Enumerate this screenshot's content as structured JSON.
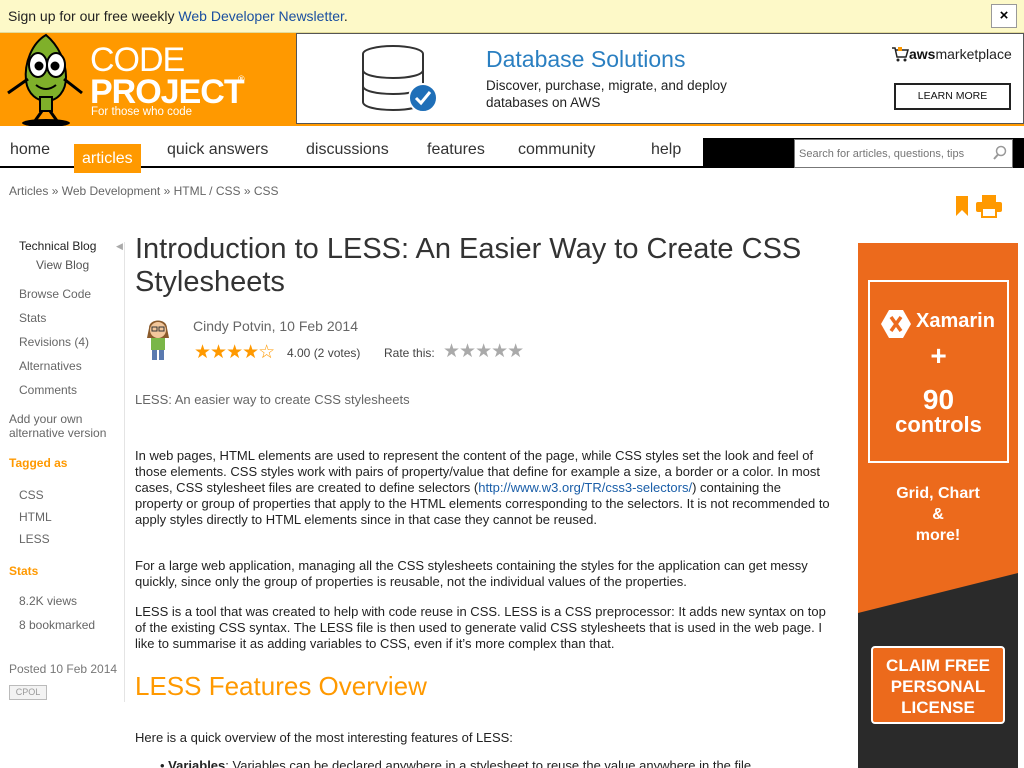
{
  "newsletter": {
    "text": "Sign up for our free weekly",
    "link": "Web Developer Newsletter",
    "period": ".",
    "close": "×"
  },
  "logo": {
    "code": "CODE",
    "project": "PROJECT",
    "reg": "®",
    "tagline": "For those who code"
  },
  "top_ad": {
    "title": "Database Solutions",
    "desc": "Discover, purchase, migrate, and deploy databases on AWS",
    "aws": "aws",
    "marketplace": "marketplace",
    "button": "LEARN MORE"
  },
  "nav": {
    "items": [
      "home",
      "articles",
      "quick answers",
      "discussions",
      "features",
      "community",
      "help"
    ],
    "search_placeholder": "Search for articles, questions, tips"
  },
  "breadcrumb": {
    "items": [
      "Articles",
      "Web Development",
      "HTML / CSS",
      "CSS"
    ],
    "sep": "»"
  },
  "sidebar": {
    "blog_title": "Technical Blog",
    "view_blog": "View Blog",
    "links": [
      "Browse Code",
      "Stats",
      "Revisions (4)",
      "Alternatives",
      "Comments"
    ],
    "add_alt": "Add your own alternative version",
    "tagged_as": "Tagged as",
    "tags": [
      "CSS",
      "HTML",
      "LESS"
    ],
    "stats_heading": "Stats",
    "stats": [
      "8.2K views",
      "8 bookmarked"
    ],
    "posted": "Posted 10 Feb 2014",
    "license": "CPOL"
  },
  "article": {
    "title": "Introduction to LESS: An Easier Way to Create CSS Stylesheets",
    "author": "Cindy Potvin",
    "date": ", 10 Feb 2014",
    "stars": "★★★★☆",
    "rating_value": 4.0,
    "rating": "4.00 (2 votes)",
    "rate_label": "Rate this:",
    "rate_stars": "★★★★★",
    "summary": "LESS: An easier way to create CSS stylesheets",
    "p1_a": "In web pages, HTML elements are used to represent the content of the page, while CSS styles set the look and feel of those elements. CSS styles work with pairs of property/value that define for example a size, a border or a color. In most cases, CSS stylesheet files are created to define selectors (",
    "p1_link": "http://www.w3.org/TR/css3-selectors/",
    "p1_b": ") containing the property or group of properties that apply to the HTML elements corresponding to the selectors. It is not recommended to apply styles directly to HTML elements since in that case they cannot be reused.",
    "p2": "For a large web application, managing all the CSS stylesheets containing the styles for the application can get messy quickly, since only the group of properties is reusable, not the individual values of the properties.",
    "p3": "LESS is a tool that was created to help with code reuse in CSS. LESS is a CSS preprocessor: It adds new syntax on top of the existing CSS syntax. The LESS file is then used to generate valid CSS stylesheets that is used in the web page. I like to summarise it as adding variables to CSS, even if it’s more complex than that.",
    "h2": "LESS Features Overview",
    "quick": "Here is a quick overview of the most interesting features of LESS:",
    "bullet_term": "Variables",
    "bullet_text": ": Variables can be declared anywhere in a stylesheet to reuse the value anywhere in the file."
  },
  "side_ad": {
    "brand": "Xamarin",
    "plus": "+",
    "count": "90",
    "controls": "controls",
    "line1": "Grid, Chart",
    "line2": "&",
    "line3": "more!",
    "claim1": "CLAIM FREE",
    "claim2": "PERSONAL",
    "claim3": "LICENSE"
  },
  "colors": {
    "brand_orange": "#ff9900",
    "ad_orange": "#ec6a1c",
    "link_blue": "#1a5ea8",
    "newsletter_bg": "#fdf9c8"
  }
}
